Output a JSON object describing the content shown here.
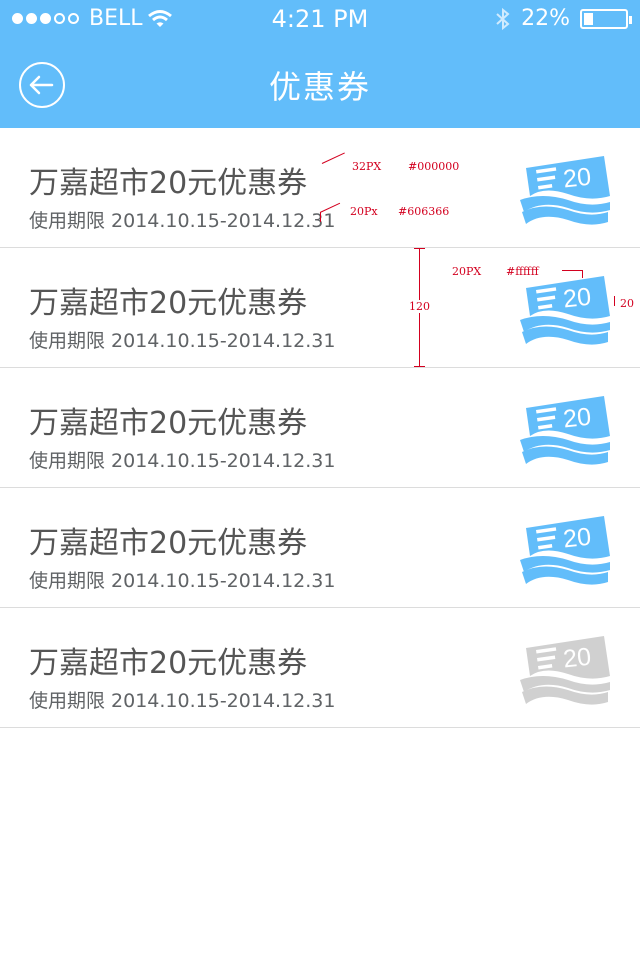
{
  "status": {
    "carrier": "BELL",
    "time": "4:21 PM",
    "battery": "22%",
    "battery_level": 0.22
  },
  "nav": {
    "title": "优惠券"
  },
  "coupons": [
    {
      "title": "万嘉超市20元优惠券",
      "validity": "使用期限 2014.10.15-2014.12.31",
      "amount": "20",
      "color": "#62bdfa"
    },
    {
      "title": "万嘉超市20元优惠券",
      "validity": "使用期限 2014.10.15-2014.12.31",
      "amount": "20",
      "color": "#62bdfa"
    },
    {
      "title": "万嘉超市20元优惠券",
      "validity": "使用期限 2014.10.15-2014.12.31",
      "amount": "20",
      "color": "#62bdfa"
    },
    {
      "title": "万嘉超市20元优惠券",
      "validity": "使用期限 2014.10.15-2014.12.31",
      "amount": "20",
      "color": "#62bdfa"
    },
    {
      "title": "万嘉超市20元优惠券",
      "validity": "使用期限 2014.10.15-2014.12.31",
      "amount": "20",
      "color": "#d0d0d0"
    }
  ],
  "annotations": {
    "title_size": "32PX",
    "title_color": "#000000",
    "date_size": "20Px",
    "date_color": "#606366",
    "row_height": "120",
    "icon_size": "20PX",
    "icon_color": "#ffffff",
    "icon_margin": "20"
  }
}
